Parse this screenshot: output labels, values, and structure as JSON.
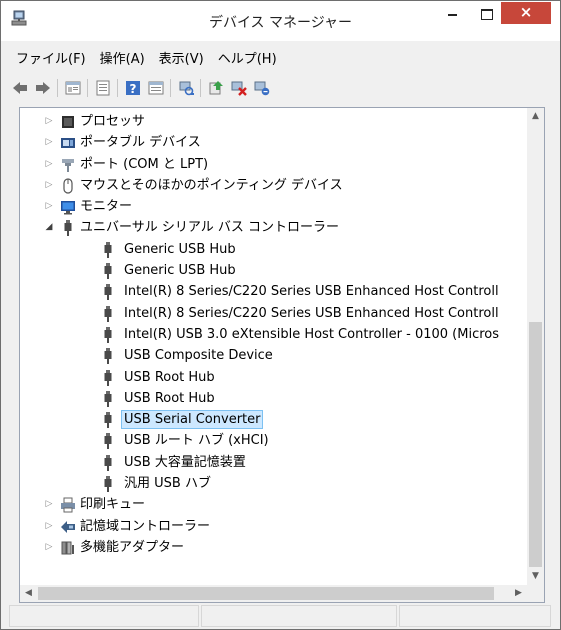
{
  "window": {
    "title": "デバイス マネージャー",
    "close_label": "×"
  },
  "menu": [
    {
      "label": "ファイル(F)"
    },
    {
      "label": "操作(A)"
    },
    {
      "label": "表示(V)"
    },
    {
      "label": "ヘルプ(H)"
    }
  ],
  "tree": {
    "top_items": [
      {
        "label": "プロセッサ",
        "icon": "processor-icon"
      },
      {
        "label": "ポータブル デバイス",
        "icon": "portable-device-icon"
      },
      {
        "label": "ポート (COM と LPT)",
        "icon": "port-icon"
      },
      {
        "label": "マウスとそのほかのポインティング デバイス",
        "icon": "mouse-icon"
      },
      {
        "label": "モニター",
        "icon": "monitor-icon"
      },
      {
        "label": "ユニバーサル シリアル バス コントローラー",
        "icon": "usb-icon"
      }
    ],
    "usb_children": [
      {
        "label": "Generic USB Hub"
      },
      {
        "label": "Generic USB Hub"
      },
      {
        "label": "Intel(R) 8 Series/C220 Series USB Enhanced Host Controll"
      },
      {
        "label": "Intel(R) 8 Series/C220 Series USB Enhanced Host Controll"
      },
      {
        "label": "Intel(R) USB 3.0 eXtensible Host Controller - 0100 (Micros"
      },
      {
        "label": "USB Composite Device"
      },
      {
        "label": "USB Root Hub"
      },
      {
        "label": "USB Root Hub"
      },
      {
        "label": "USB Serial Converter"
      },
      {
        "label": "USB ルート ハブ (xHCI)"
      },
      {
        "label": "USB 大容量記憶装置"
      },
      {
        "label": "汎用 USB ハブ"
      }
    ],
    "bottom_items": [
      {
        "label": "印刷キュー",
        "icon": "print-queue-icon"
      },
      {
        "label": "記憶域コントローラー",
        "icon": "storage-controller-icon"
      },
      {
        "label": "多機能アダプター",
        "icon": "multifunction-adapter-icon"
      }
    ],
    "selected": "USB Serial Converter"
  },
  "colors": {
    "selection_bg": "#cde8ff",
    "selection_border": "#7dc1f2",
    "close_button": "#c7473a"
  }
}
